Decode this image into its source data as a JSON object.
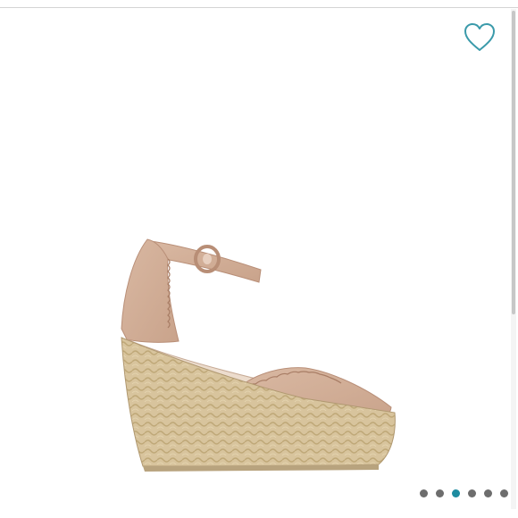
{
  "product": {
    "image_icon": "espadrille-wedge-sandal",
    "favorite_icon": "heart-outline-icon",
    "accent_color": "#3a9aaa"
  },
  "gallery": {
    "image_count": 6,
    "active_index": 2,
    "dot_color": "#6d6d6d",
    "active_dot_color": "#1e8ca0"
  }
}
